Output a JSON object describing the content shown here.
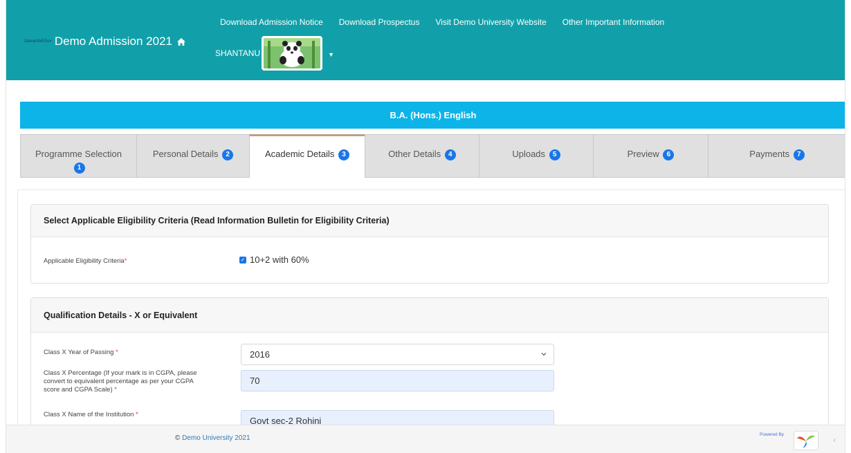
{
  "header": {
    "brand_logo_text": "SamarthEGov",
    "title": "Demo Admission 2021",
    "nav": [
      "Download Admission Notice",
      "Download Prospectus",
      "Visit Demo University Website",
      "Other Important Information"
    ],
    "user_name": "SHANTANU"
  },
  "programme": "B.A. (Hons.) English",
  "tabs": [
    {
      "label": "Programme Selection",
      "badge": "1"
    },
    {
      "label": "Personal Details",
      "badge": "2"
    },
    {
      "label": "Academic Details",
      "badge": "3",
      "active": true
    },
    {
      "label": "Other Details",
      "badge": "4"
    },
    {
      "label": "Uploads",
      "badge": "5"
    },
    {
      "label": "Preview",
      "badge": "6"
    },
    {
      "label": "Payments",
      "badge": "7"
    }
  ],
  "eligibility": {
    "heading": "Select Applicable Eligibility Criteria (Read Information Bulletin for Eligibility Criteria)",
    "label": "Applicable Eligibility Criteria",
    "required_mark": "*",
    "option": "10+2 with 60%",
    "checked": true
  },
  "qualification": {
    "heading": "Qualification Details - X or Equivalent",
    "year_label": "Class X Year of Passing",
    "year_value": "2016",
    "percentage_label_lines": [
      "Class X Percentage (If your mark is in CGPA, please",
      "convert to equivalent percentage as per your CGPA",
      "score and CGPA Scale)"
    ],
    "percentage_value": "70",
    "institution_label": "Class X Name of the Institution",
    "institution_value": "Govt sec-2 Rohini",
    "required_mark": "*"
  },
  "footer": {
    "copyright_symbol": "©",
    "copyright_text": "Demo University 2021",
    "powered_by": "Powered By"
  },
  "colors": {
    "header_bg": "#11a0a9",
    "programme_bar": "#0db4e8",
    "badge": "#1976e8",
    "active_tab_border": "#b8a18b",
    "filled_input": "#e8f0fe"
  }
}
